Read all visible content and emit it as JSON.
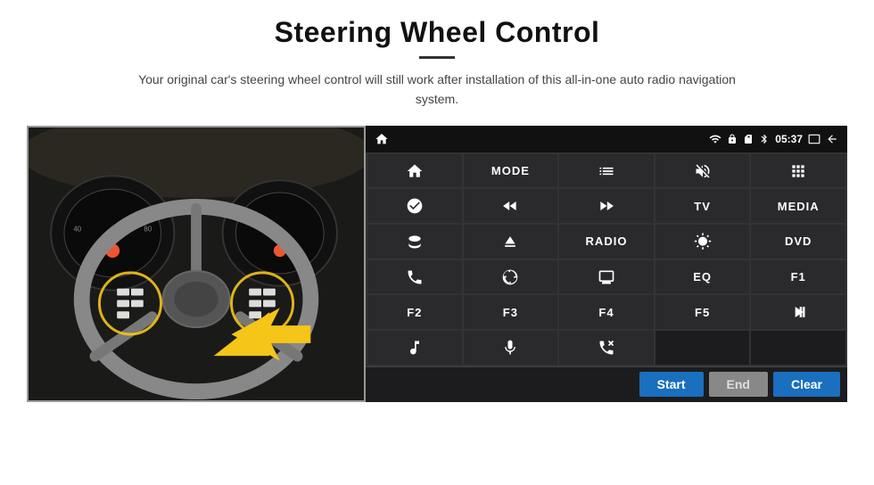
{
  "header": {
    "title": "Steering Wheel Control",
    "divider": true,
    "subtitle": "Your original car's steering wheel control will still work after installation of this all-in-one auto radio navigation system."
  },
  "statusBar": {
    "wifi_icon": "wifi",
    "lock_icon": "lock",
    "sd_icon": "sd",
    "bt_icon": "bt",
    "time": "05:37",
    "screen_icon": "screen",
    "back_icon": "back"
  },
  "buttons": [
    {
      "id": "r1c1",
      "type": "icon",
      "icon": "home"
    },
    {
      "id": "r1c2",
      "type": "text",
      "label": "MODE"
    },
    {
      "id": "r1c3",
      "type": "icon",
      "icon": "list"
    },
    {
      "id": "r1c4",
      "type": "icon",
      "icon": "mute"
    },
    {
      "id": "r1c5",
      "type": "icon",
      "icon": "grid"
    },
    {
      "id": "r2c1",
      "type": "icon",
      "icon": "settings"
    },
    {
      "id": "r2c2",
      "type": "icon",
      "icon": "rewind"
    },
    {
      "id": "r2c3",
      "type": "icon",
      "icon": "forward"
    },
    {
      "id": "r2c4",
      "type": "text",
      "label": "TV"
    },
    {
      "id": "r2c5",
      "type": "text",
      "label": "MEDIA"
    },
    {
      "id": "r3c1",
      "type": "icon",
      "icon": "360"
    },
    {
      "id": "r3c2",
      "type": "icon",
      "icon": "eject"
    },
    {
      "id": "r3c3",
      "type": "text",
      "label": "RADIO"
    },
    {
      "id": "r3c4",
      "type": "icon",
      "icon": "brightness"
    },
    {
      "id": "r3c5",
      "type": "text",
      "label": "DVD"
    },
    {
      "id": "r4c1",
      "type": "icon",
      "icon": "phone"
    },
    {
      "id": "r4c2",
      "type": "icon",
      "icon": "navigation"
    },
    {
      "id": "r4c3",
      "type": "icon",
      "icon": "display"
    },
    {
      "id": "r4c4",
      "type": "text",
      "label": "EQ"
    },
    {
      "id": "r4c5",
      "type": "text",
      "label": "F1"
    },
    {
      "id": "r5c1",
      "type": "text",
      "label": "F2"
    },
    {
      "id": "r5c2",
      "type": "text",
      "label": "F3"
    },
    {
      "id": "r5c3",
      "type": "text",
      "label": "F4"
    },
    {
      "id": "r5c4",
      "type": "text",
      "label": "F5"
    },
    {
      "id": "r5c5",
      "type": "icon",
      "icon": "playpause"
    },
    {
      "id": "r6c1",
      "type": "icon",
      "icon": "music"
    },
    {
      "id": "r6c2",
      "type": "icon",
      "icon": "microphone"
    },
    {
      "id": "r6c3",
      "type": "icon",
      "icon": "phonecall"
    },
    {
      "id": "r6c4",
      "type": "empty",
      "label": ""
    },
    {
      "id": "r6c5",
      "type": "empty",
      "label": ""
    }
  ],
  "bottomBar": {
    "start_label": "Start",
    "end_label": "End",
    "clear_label": "Clear"
  }
}
